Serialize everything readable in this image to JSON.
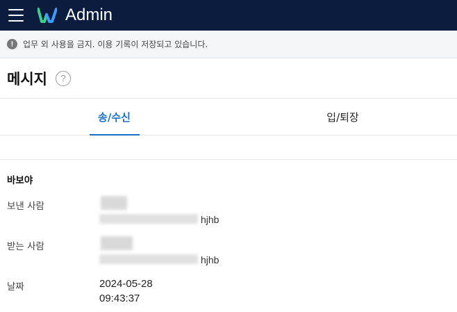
{
  "topbar": {
    "app_title": "Admin"
  },
  "notice": {
    "text": "업무 외 사용을 금지. 이용 기록이 저장되고 있습니다."
  },
  "page": {
    "title": "메시지",
    "help_glyph": "?"
  },
  "tabs": [
    {
      "label": "송/수신",
      "active": true
    },
    {
      "label": "입/퇴장",
      "active": false
    }
  ],
  "message": {
    "subject": "바보야",
    "sender_label": "보낸 사람",
    "sender_suffix": "hjhb",
    "receiver_label": "받는 사람",
    "receiver_suffix": "hjhb",
    "date_label": "날짜",
    "date": "2024-05-28",
    "time": "09:43:37"
  },
  "colors": {
    "topbar": "#0b1c3f",
    "accent": "#1a6fc9",
    "logo_green": "#3ecf8e",
    "logo_blue": "#3aa0ff"
  }
}
